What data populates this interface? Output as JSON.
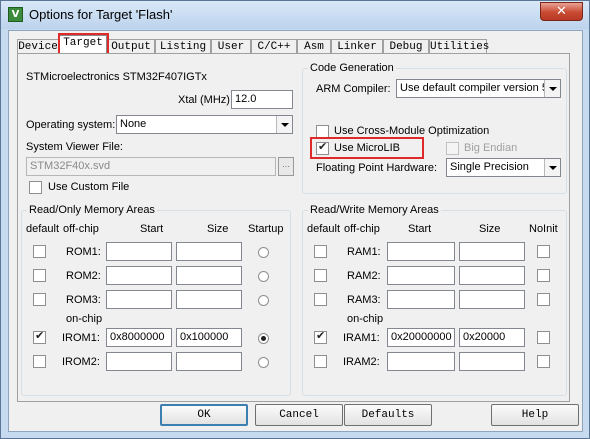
{
  "window": {
    "title": "Options for Target 'Flash'",
    "close_glyph": "✕",
    "icon": "keil-app-icon"
  },
  "tabs": [
    "Device",
    "Target",
    "Output",
    "Listing",
    "User",
    "C/C++",
    "Asm",
    "Linker",
    "Debug",
    "Utilities"
  ],
  "active_tab": "Target",
  "target": {
    "device_name": "STMicroelectronics STM32F407IGTx",
    "xtal_label": "Xtal (MHz):",
    "xtal_value": "12.0",
    "os_label": "Operating system:",
    "os_value": "None",
    "svf_label": "System Viewer File:",
    "svf_value": "STM32F40x.svd",
    "svf_browse": "...",
    "use_custom_file_label": "Use Custom File",
    "use_custom_file_checked": false
  },
  "codegen": {
    "title": "Code Generation",
    "arm_compiler_label": "ARM Compiler:",
    "arm_compiler_value": "Use default compiler version 5",
    "cross_module_label": "Use Cross-Module Optimization",
    "cross_module_checked": false,
    "microlib_label": "Use MicroLIB",
    "microlib_checked": true,
    "big_endian_label": "Big Endian",
    "big_endian_checked": false,
    "fp_label": "Floating Point Hardware:",
    "fp_value": "Single Precision"
  },
  "ro_memory": {
    "title": "Read/Only Memory Areas",
    "headers": {
      "default": "default",
      "offchip": "off-chip",
      "start": "Start",
      "size": "Size",
      "startup": "Startup"
    },
    "onchip_label": "on-chip",
    "rows": [
      {
        "name": "ROM1:",
        "default": false,
        "start": "",
        "size": "",
        "startup": false
      },
      {
        "name": "ROM2:",
        "default": false,
        "start": "",
        "size": "",
        "startup": false
      },
      {
        "name": "ROM3:",
        "default": false,
        "start": "",
        "size": "",
        "startup": false
      },
      {
        "name": "IROM1:",
        "default": true,
        "start": "0x8000000",
        "size": "0x100000",
        "startup": true
      },
      {
        "name": "IROM2:",
        "default": false,
        "start": "",
        "size": "",
        "startup": false
      }
    ]
  },
  "rw_memory": {
    "title": "Read/Write Memory Areas",
    "headers": {
      "default": "default",
      "offchip": "off-chip",
      "start": "Start",
      "size": "Size",
      "noinit": "NoInit"
    },
    "onchip_label": "on-chip",
    "rows": [
      {
        "name": "RAM1:",
        "default": false,
        "start": "",
        "size": "",
        "noinit": false
      },
      {
        "name": "RAM2:",
        "default": false,
        "start": "",
        "size": "",
        "noinit": false
      },
      {
        "name": "RAM3:",
        "default": false,
        "start": "",
        "size": "",
        "noinit": false
      },
      {
        "name": "IRAM1:",
        "default": true,
        "start": "0x20000000",
        "size": "0x20000",
        "noinit": false
      },
      {
        "name": "IRAM2:",
        "default": false,
        "start": "",
        "size": "",
        "noinit": false
      }
    ]
  },
  "buttons": {
    "ok": "OK",
    "cancel": "Cancel",
    "defaults": "Defaults",
    "help": "Help"
  },
  "colors": {
    "highlight": "#e02a2a",
    "title_bar": "#c6dbf0"
  }
}
